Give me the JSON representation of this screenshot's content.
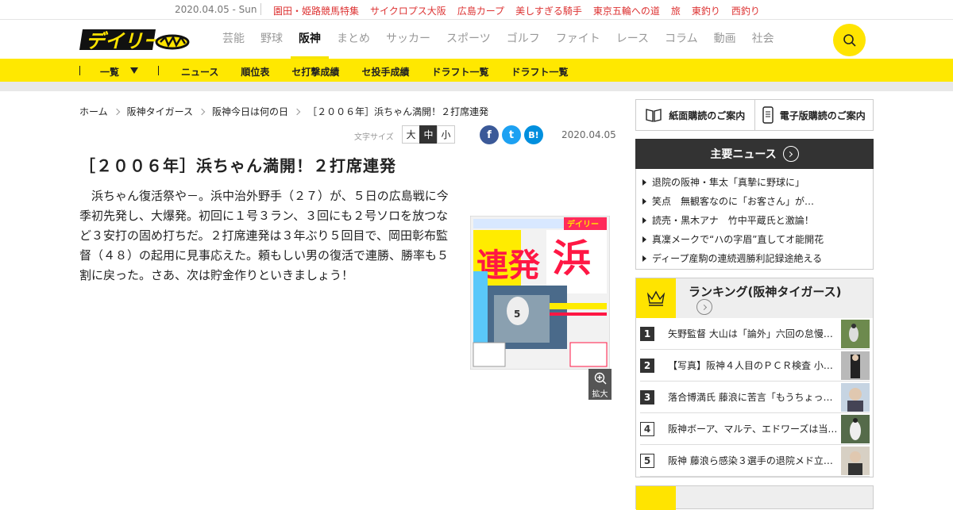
{
  "topbar": {
    "date": "2020.04.05 - Sun",
    "links": [
      "園田・姫路競馬特集",
      "サイクロプス大阪",
      "広島カープ",
      "美しすぎる騎手",
      "東京五輪への道",
      "旅",
      "東釣り",
      "西釣り"
    ]
  },
  "header": {
    "logo_text": "デイリー",
    "nav": [
      "芸能",
      "野球",
      "阪神",
      "まとめ",
      "サッカー",
      "スポーツ",
      "ゴルフ",
      "ファイト",
      "レース",
      "コラム",
      "動画",
      "社会"
    ],
    "active_nav": "阪神"
  },
  "subnav": {
    "list_label": "一覧",
    "items": [
      "ニュース",
      "順位表",
      "セ打撃成績",
      "セ投手成績",
      "ドラフト一覧",
      "ドラフト一覧"
    ]
  },
  "breadcrumb": [
    "ホーム",
    "阪神タイガース",
    "阪神今日は何の日",
    "［２００６年］浜ちゃん満開！２打席連発"
  ],
  "font_size": {
    "label": "文字サイズ",
    "options": [
      "大",
      "中",
      "小"
    ],
    "selected": "中"
  },
  "share": {
    "facebook": "f",
    "twitter": "t",
    "hatena": "B!"
  },
  "article": {
    "date": "2020.04.05",
    "title": "［２００６年］浜ちゃん満開！２打席連発",
    "body": "浜ちゃん復活祭や－。浜中治外野手（２７）が、５日の広島戦に今季初先発し、大爆発。初回に１号３ラン、３回にも２号ソロを放つなど３安打の固め打ちだ。２打席連発は３年ぶり５回目で、岡田彰布監督（４８）の起用に見事応えた。頼もしい男の復活で連勝、勝率も５割に戻った。さあ、次は貯金作りといきましょう！",
    "photo": {
      "masthead": "デイリー",
      "headline_1": "連発",
      "headline_2": "浜",
      "player_number": "5"
    },
    "zoom_label": "拡大"
  },
  "sidebar": {
    "subscribe_paper": "紙面購読のご案内",
    "subscribe_digital": "電子版購読のご案内",
    "news_title": "主要ニュース",
    "news_items": [
      "退院の阪神・隼太「真摯に野球に」",
      "笑点　無観客なのに「お客さん」が…",
      "読売・黒木アナ　竹中平蔵氏と激論！",
      "真凜メークで“ハの字眉”直してオ能開花",
      "ディープ産駒の連続週勝利記録途絶える"
    ],
    "ranking_title": "ランキング(阪神タイガース)",
    "ranking": [
      {
        "rank": "1",
        "title": "矢野監督 大山は「論外」六回の怠慢…"
      },
      {
        "rank": "2",
        "title": "【写真】阪神４人目のＰＣＲ検査 小…"
      },
      {
        "rank": "3",
        "title": "落合博満氏 藤浪に苦言「もうちょっ…"
      },
      {
        "rank": "4",
        "title": "阪神ボーア、マルテ、エドワーズは当…"
      },
      {
        "rank": "5",
        "title": "阪神 藤浪ら感染３選手の退院メド立…"
      }
    ]
  },
  "colors": {
    "accent_yellow": "#ffe400",
    "link_red": "#d33333",
    "dark": "#333333"
  }
}
